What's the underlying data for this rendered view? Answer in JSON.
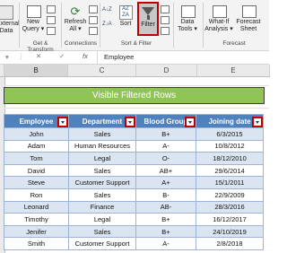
{
  "ribbon": {
    "external_data_label": "External",
    "external_data_label2": "Data",
    "new_query_label": "New",
    "new_query_label2": "Query",
    "refresh_all_label": "Refresh",
    "refresh_all_label2": "All",
    "sort_az_label": "A↓Z",
    "sort_za_label": "Z↓A",
    "sort_label": "Sort",
    "filter_label": "Filter",
    "data_tools_label": "Data",
    "data_tools_label2": "Tools",
    "what_if_label": "What-If",
    "what_if_label2": "Analysis",
    "forecast_sheet_label": "Forecast",
    "forecast_sheet_label2": "Sheet",
    "group_get_transform": "Get & Transform",
    "group_connections": "Connections",
    "group_sort_filter": "Sort & Filter",
    "group_forecast": "Forecast"
  },
  "formula_bar": {
    "cancel": "✕",
    "enter": "✓",
    "fx": "fx",
    "value": "Employee"
  },
  "columns": [
    "B",
    "C",
    "D",
    "E"
  ],
  "banner": "Visible Filtered Rows",
  "table": {
    "headers": [
      "Employee",
      "Department",
      "Blood Group",
      "Joining date"
    ],
    "rows": [
      [
        "John",
        "Sales",
        "B+",
        "6/3/2015"
      ],
      [
        "Adam",
        "Human Resources",
        "A-",
        "10/8/2012"
      ],
      [
        "Tom",
        "Legal",
        "O-",
        "18/12/2010"
      ],
      [
        "David",
        "Sales",
        "AB+",
        "29/6/2014"
      ],
      [
        "Steve",
        "Customer Support",
        "A+",
        "15/1/2011"
      ],
      [
        "Ron",
        "Sales",
        "B-",
        "22/9/2009"
      ],
      [
        "Leonard",
        "Finance",
        "AB-",
        "28/3/2016"
      ],
      [
        "Timothy",
        "Legal",
        "B+",
        "16/12/2017"
      ],
      [
        "Jenifer",
        "Sales",
        "B+",
        "24/10/2019"
      ],
      [
        "Smith",
        "Customer Support",
        "A-",
        "2/8/2018"
      ]
    ]
  },
  "colors": {
    "header_blue": "#4f81bd",
    "banner_green": "#8fc552",
    "highlight_red": "#c00000"
  }
}
